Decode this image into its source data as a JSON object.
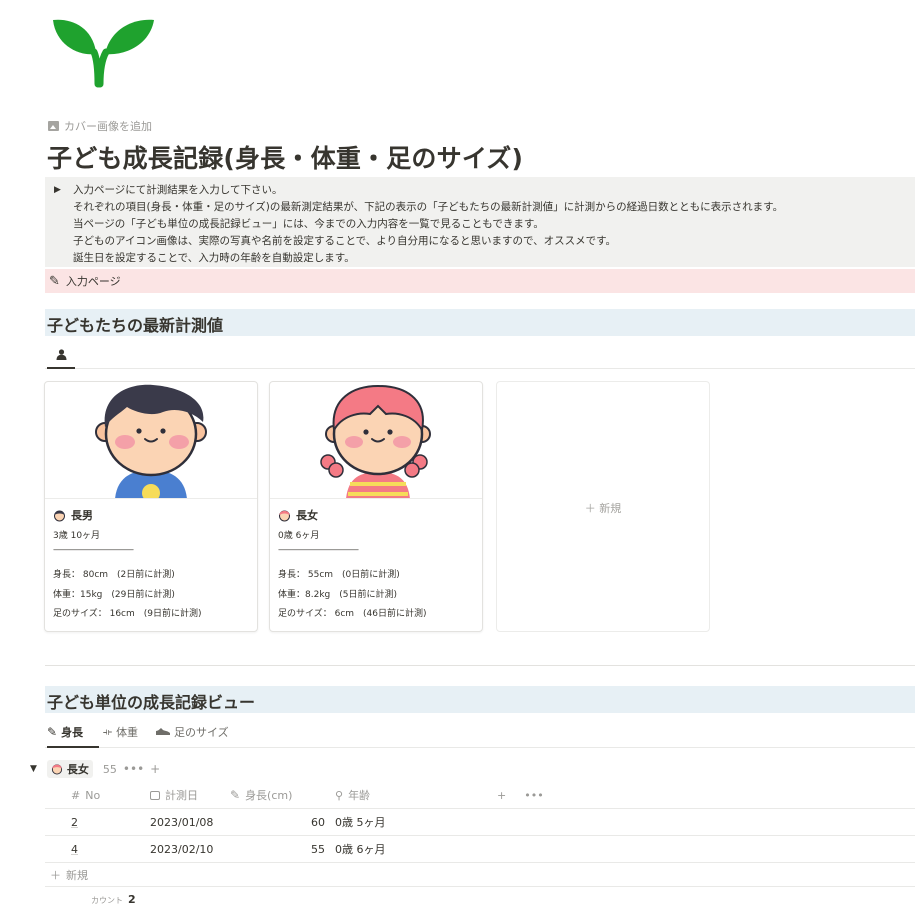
{
  "page": {
    "cover_add_label": "カバー画像を追加",
    "title": "子ども成長記録(身長・体重・足のサイズ)",
    "colors": {
      "callout_gray": "#f1f1ef",
      "callout_pink": "#fbe4e4",
      "heading_bg": "#e7f0f5",
      "sprout_green": "#1fa22e"
    }
  },
  "intro": {
    "lines": [
      "入力ページにて計測結果を入力して下さい。",
      "それぞれの項目(身長・体重・足のサイズ)の最新測定結果が、下記の表示の「子どもたちの最新計測値」に計測からの経過日数とともに表示されます。",
      "当ページの「子ども単位の成長記録ビュー」には、今までの入力内容を一覧で見ることもできます。",
      "子どものアイコン画像は、実際の写真や名前を設定することで、より自分用になると思いますので、オススメです。",
      "誕生日を設定することで、入力時の年齢を自動設定します。"
    ]
  },
  "input_link": {
    "label": "入力ページ",
    "icon": "pencil-icon"
  },
  "latest": {
    "heading": "子どもたちの最新計測値",
    "view_icon": "person-icon",
    "cards": [
      {
        "name": "長男",
        "age": "3歳 10ヶ月",
        "separator": "——————————",
        "height": "身長： 80cm　(2日前に計測)",
        "weight": "体重：15kg　(29日前に計測)",
        "foot": "足のサイズ： 16cm　(9日前に計測)"
      },
      {
        "name": "長女",
        "age": "0歳 6ヶ月",
        "separator": "——————————",
        "height": "身長： 55cm　(0日前に計測)",
        "weight": "体重：8.2kg　(5日前に計測)",
        "foot": "足のサイズ： 6cm　(46日前に計測)"
      }
    ],
    "new_label": "新規"
  },
  "records": {
    "heading": "子ども単位の成長記録ビュー",
    "tabs": [
      {
        "label": "身長",
        "icon": "pencil-icon"
      },
      {
        "label": "体重",
        "icon": "dumbbell-icon"
      },
      {
        "label": "足のサイズ",
        "icon": "shoe-icon"
      }
    ],
    "group": {
      "name": "長女",
      "count": "55",
      "dots": "•••",
      "plus": "+"
    },
    "columns": {
      "no": "No",
      "date": "計測日",
      "height": "身長(cm)",
      "age": "年齢",
      "add": "+",
      "more": "•••"
    },
    "rows": [
      {
        "no": "2",
        "date": "2023/01/08",
        "height": "60",
        "age": "0歳 5ヶ月"
      },
      {
        "no": "4",
        "date": "2023/02/10",
        "height": "55",
        "age": "0歳 6ヶ月"
      }
    ],
    "new_label": "新規",
    "count_label": "カウント",
    "count_value": "2"
  }
}
